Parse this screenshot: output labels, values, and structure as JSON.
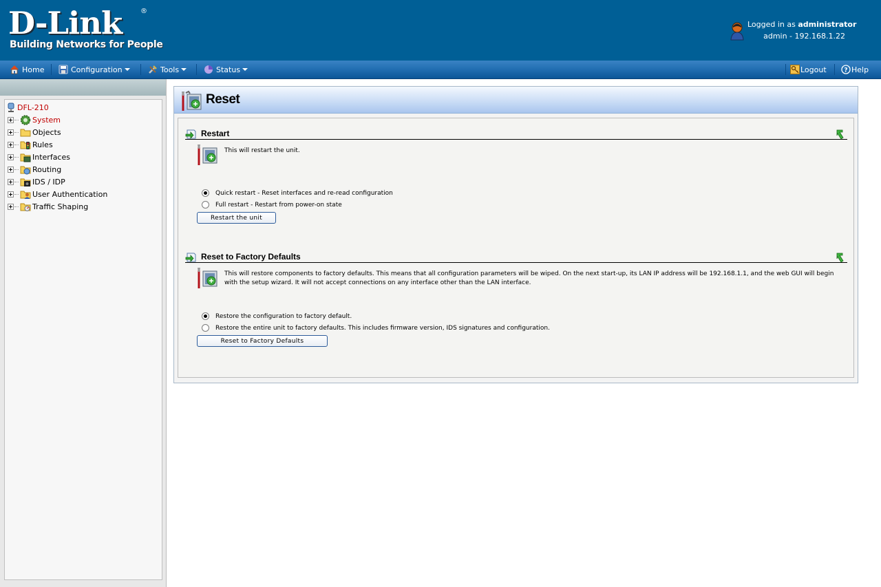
{
  "header": {
    "brand": "D-Link",
    "tagline": "Building Networks for People",
    "login_prefix": "Logged in as",
    "login_user": "administrator",
    "session": "admin - 192.168.1.22"
  },
  "menubar": {
    "home": "Home",
    "configuration": "Configuration",
    "tools": "Tools",
    "status": "Status",
    "logout": "Logout",
    "help": "Help"
  },
  "tree": {
    "root": "DFL-210",
    "items": [
      {
        "label": "System"
      },
      {
        "label": "Objects"
      },
      {
        "label": "Rules"
      },
      {
        "label": "Interfaces"
      },
      {
        "label": "Routing"
      },
      {
        "label": "IDS / IDP"
      },
      {
        "label": "User Authentication"
      },
      {
        "label": "Traffic Shaping"
      }
    ]
  },
  "panel": {
    "title": "Reset",
    "restart": {
      "heading": "Restart",
      "description": "This will restart the unit.",
      "options": [
        {
          "label": "Quick restart - Reset interfaces and re-read configuration",
          "checked": true
        },
        {
          "label": "Full restart - Restart from power-on state",
          "checked": false
        }
      ],
      "button": "Restart the unit"
    },
    "factory": {
      "heading": "Reset to Factory Defaults",
      "description": "This will restore components to factory defaults. This means that all configuration parameters will be wiped. On the next start-up, its LAN IP address will be 192.168.1.1, and the web GUI will begin with the setup wizard. It will not accept connections on any interface other than the LAN interface.",
      "options": [
        {
          "label": "Restore the configuration to factory default.",
          "checked": true
        },
        {
          "label": "Restore the entire unit to factory defaults. This includes firmware version, IDS signatures and configuration.",
          "checked": false
        }
      ],
      "button": "Reset to Factory Defaults"
    }
  },
  "colors": {
    "header_bg": "#005f96",
    "menubar": "#2370b3",
    "tree_highlight": "#c00000"
  }
}
